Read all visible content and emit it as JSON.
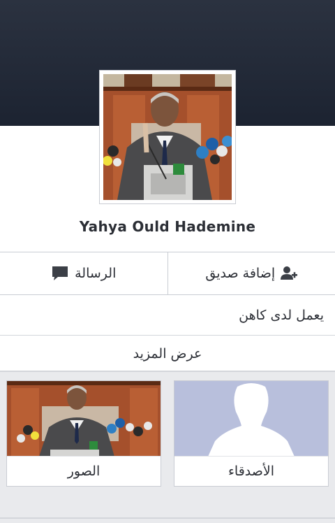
{
  "profile": {
    "name": "Yahya Ould Hademine",
    "avatar_alt": "profile photo"
  },
  "actions": {
    "add_friend_label": "إضافة صديق",
    "message_label": "الرسالة"
  },
  "about": {
    "work_line": "يعمل لدى كاهن",
    "see_more_label": "عرض المزيد"
  },
  "tiles": {
    "friends_label": "الأصدقاء",
    "photos_label": "الصور"
  },
  "colors": {
    "cover": "#232a38",
    "page_background": "#e9eaed",
    "text": "#2b2e35",
    "divider": "#c9ccd3",
    "placeholder_avatar": "#b8bfdc"
  },
  "icons": {
    "add_friend": "add-friend-icon",
    "message": "message-bubble-icon"
  }
}
